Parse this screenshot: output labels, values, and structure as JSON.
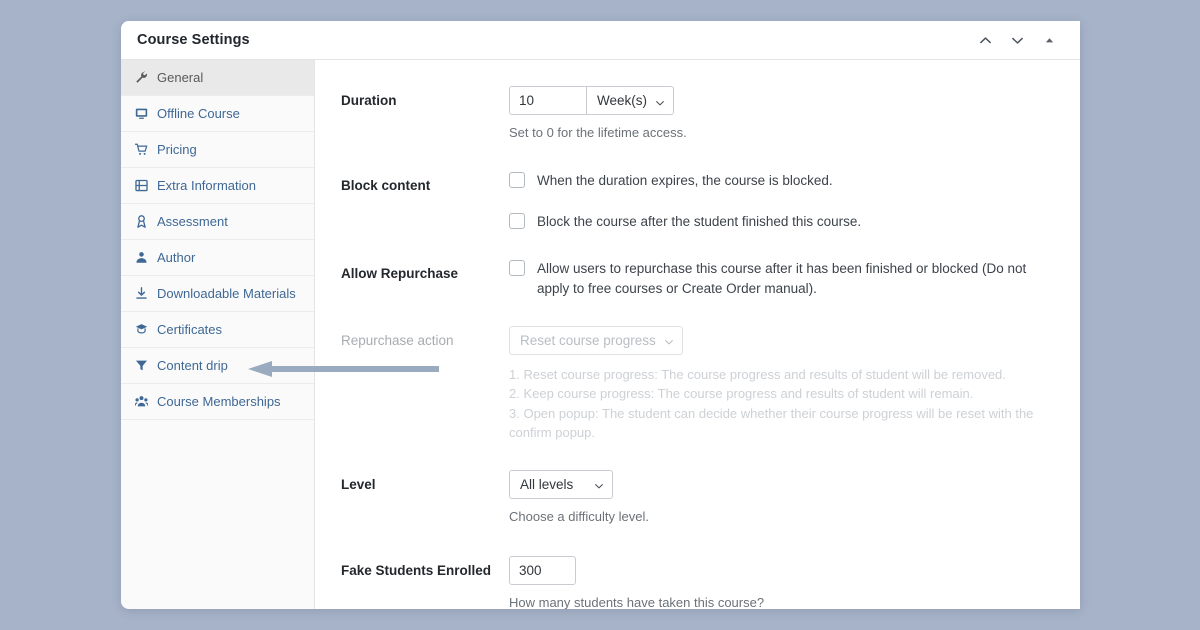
{
  "window": {
    "title": "Course Settings",
    "controls": [
      {
        "name": "chevron-up-icon",
        "label": "Move up"
      },
      {
        "name": "chevron-down-icon",
        "label": "Move down"
      },
      {
        "name": "collapse-triangle-icon",
        "label": "Collapse panel"
      }
    ]
  },
  "sidebar": {
    "items": [
      {
        "label": "General",
        "icon": "wrench-icon",
        "active": true
      },
      {
        "label": "Offline Course",
        "icon": "monitor-icon",
        "active": false
      },
      {
        "label": "Pricing",
        "icon": "cart-icon",
        "active": false
      },
      {
        "label": "Extra Information",
        "icon": "book-icon",
        "active": false
      },
      {
        "label": "Assessment",
        "icon": "medal-icon",
        "active": false
      },
      {
        "label": "Author",
        "icon": "user-icon",
        "active": false
      },
      {
        "label": "Downloadable Materials",
        "icon": "download-icon",
        "active": false
      },
      {
        "label": "Certificates",
        "icon": "certificate-icon",
        "active": false
      },
      {
        "label": "Content drip",
        "icon": "funnel-icon",
        "active": false
      },
      {
        "label": "Course Memberships",
        "icon": "group-icon",
        "active": false
      }
    ]
  },
  "main": {
    "duration": {
      "label": "Duration",
      "value": "10",
      "unit": "Week(s)",
      "hint": "Set to 0 for the lifetime access."
    },
    "block_content": {
      "label": "Block content",
      "option1": "When the duration expires, the course is blocked.",
      "option2": "Block the course after the student finished this course."
    },
    "allow_repurchase": {
      "label": "Allow Repurchase",
      "option": "Allow users to repurchase this course after it has been finished or blocked (Do not apply to free courses or Create Order manual)."
    },
    "repurchase_action": {
      "label": "Repurchase action",
      "value": "Reset course progress",
      "hint_line1": "1. Reset course progress: The course progress and results of student will be removed.",
      "hint_line2": "2. Keep course progress: The course progress and results of student will remain.",
      "hint_line3": "3. Open popup: The student can decide whether their course progress will be reset with the confirm popup."
    },
    "level": {
      "label": "Level",
      "value": "All levels",
      "hint": "Choose a difficulty level."
    },
    "fake_students": {
      "label": "Fake Students Enrolled",
      "value": "300",
      "hint": "How many students have taken this course?"
    }
  },
  "annotation": {
    "name": "content-drip-pointer-arrow",
    "color": "#9aaabf"
  },
  "colors": {
    "page_background": "#a7b3c9",
    "sidebar_link": "#3f6895",
    "accent": "#9aaabf"
  }
}
